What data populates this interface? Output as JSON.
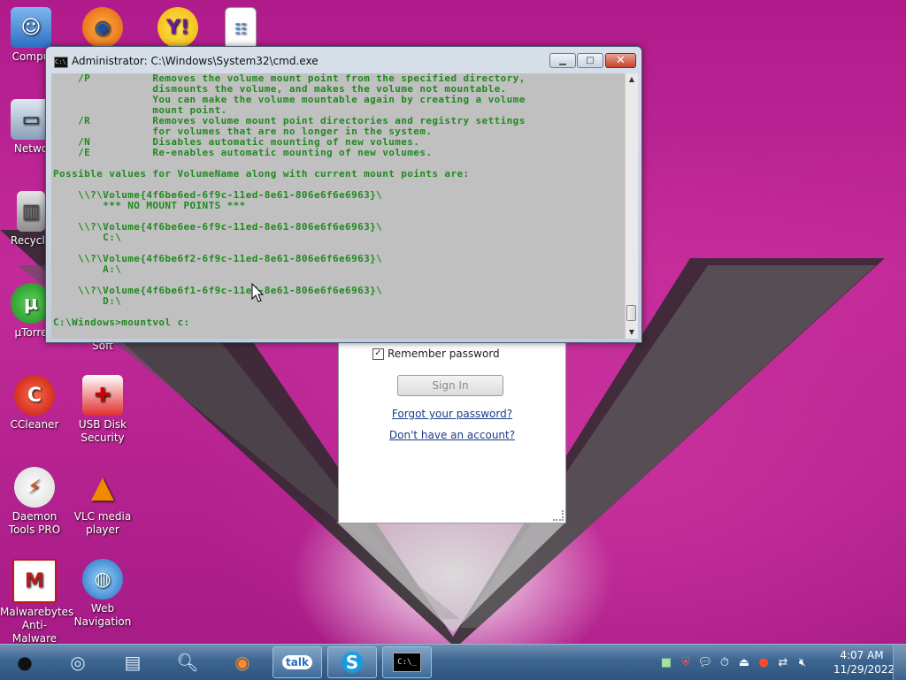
{
  "desktop_icons": [
    {
      "label": "Compu",
      "icon": "finder-icon"
    },
    {
      "label": "",
      "icon": "firefox-icon"
    },
    {
      "label": "",
      "icon": "yahoo-messenger-icon"
    },
    {
      "label": "",
      "icon": "document-icon"
    },
    {
      "label": "Netwo",
      "icon": "network-icon"
    },
    {
      "label": "Recycle",
      "icon": "recycle-bin-icon"
    },
    {
      "label": "µTorre",
      "icon": "utorrent-icon"
    },
    {
      "label": "Soft",
      "icon": "software-icon"
    },
    {
      "label": "CCleaner",
      "icon": "ccleaner-icon"
    },
    {
      "label": "USB Disk Security",
      "icon": "usb-disk-security-icon"
    },
    {
      "label": "Daemon Tools PRO",
      "icon": "daemon-tools-icon"
    },
    {
      "label": "VLC media player",
      "icon": "vlc-icon"
    },
    {
      "label": "Malwarebytes Anti-Malware",
      "icon": "malwarebytes-icon"
    },
    {
      "label": "Web Navigation",
      "icon": "web-navigation-icon"
    }
  ],
  "login": {
    "remember_label": "Remember password",
    "remember_checked": "✓",
    "signin_label": "Sign In",
    "forgot_label": "Forgot your password?",
    "signup_label": "Don't have an account?"
  },
  "cmd": {
    "title": "Administrator: C:\\Windows\\System32\\cmd.exe",
    "minimize": "▁",
    "maximize": "□",
    "close": "✕",
    "lines": [
      "    /P          Removes the volume mount point from the specified directory,",
      "                dismounts the volume, and makes the volume not mountable.",
      "                You can make the volume mountable again by creating a volume",
      "                mount point.",
      "    /R          Removes volume mount point directories and registry settings",
      "                for volumes that are no longer in the system.",
      "    /N          Disables automatic mounting of new volumes.",
      "    /E          Re-enables automatic mounting of new volumes.",
      "",
      "Possible values for VolumeName along with current mount points are:",
      "",
      "    \\\\?\\Volume{4f6be6ed-6f9c-11ed-8e61-806e6f6e6963}\\",
      "        *** NO MOUNT POINTS ***",
      "",
      "    \\\\?\\Volume{4f6be6ee-6f9c-11ed-8e61-806e6f6e6963}\\",
      "        C:\\",
      "",
      "    \\\\?\\Volume{4f6be6f2-6f9c-11ed-8e61-806e6f6e6963}\\",
      "        A:\\",
      "",
      "    \\\\?\\Volume{4f6be6f1-6f9c-11ed-8e61-806e6f6e6963}\\",
      "        D:\\",
      "",
      ""
    ],
    "prompt": "C:\\Windows>mountvol c:"
  },
  "taskbar": {
    "apps": [
      "apple-menu-icon",
      "safari-icon",
      "file-manager-icon",
      "search-icon",
      "firefox-icon",
      "google-talk-icon",
      "skype-icon",
      "cmd-icon"
    ],
    "talk_label": "talk",
    "cmd_label": "C:\\_",
    "clock_time": "4:07 AM",
    "clock_date": "11/29/2022"
  },
  "colors": {
    "console_bg": "#c0c0c0",
    "console_text": "#1f8a1f",
    "desktop": "#b01b8c"
  }
}
